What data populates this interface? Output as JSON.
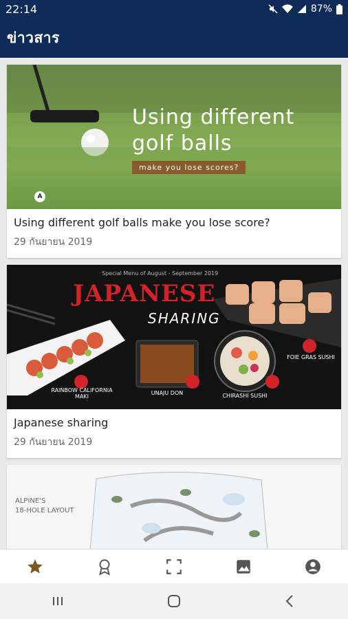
{
  "status_bar": {
    "time": "22:14",
    "battery": "87%"
  },
  "app_bar": {
    "title": "ข่าวสาร"
  },
  "feed": {
    "items": [
      {
        "title": "Using different golf balls make you lose score?",
        "date": "29 กันยายน 2019",
        "image_text": {
          "headline_line1": "Using different",
          "headline_line2": "golf balls",
          "tag": "make you lose scores?",
          "badge": "A"
        }
      },
      {
        "title": "Japanese sharing",
        "date": "29 กันยายน 2019",
        "image_text": {
          "menu_note": "Special Menu of August - September 2019",
          "headline": "JAPANESE",
          "subheadline": "SHARING",
          "label_maki": "RAINBOW CALIFORNIA MAKI",
          "label_unaju": "UNAJU DON",
          "label_chirashi": "CHIRASHI SUSHI",
          "label_foie": "FOIE GRAS SUSHI"
        }
      },
      {
        "title": "",
        "date": "",
        "image_text": {
          "line1": "ALPINE'S",
          "line2": "18-HOLE LAYOUT"
        }
      }
    ]
  },
  "bottom_nav": {
    "items": [
      {
        "icon": "star-icon",
        "active": true
      },
      {
        "icon": "award-icon",
        "active": false
      },
      {
        "icon": "scan-icon",
        "active": false
      },
      {
        "icon": "gallery-icon",
        "active": false
      },
      {
        "icon": "profile-icon",
        "active": false
      }
    ],
    "active_color": "#7a5a1e",
    "inactive_color": "#555555"
  },
  "colors": {
    "primary": "#0f2b57",
    "background": "#e9e9e9"
  }
}
